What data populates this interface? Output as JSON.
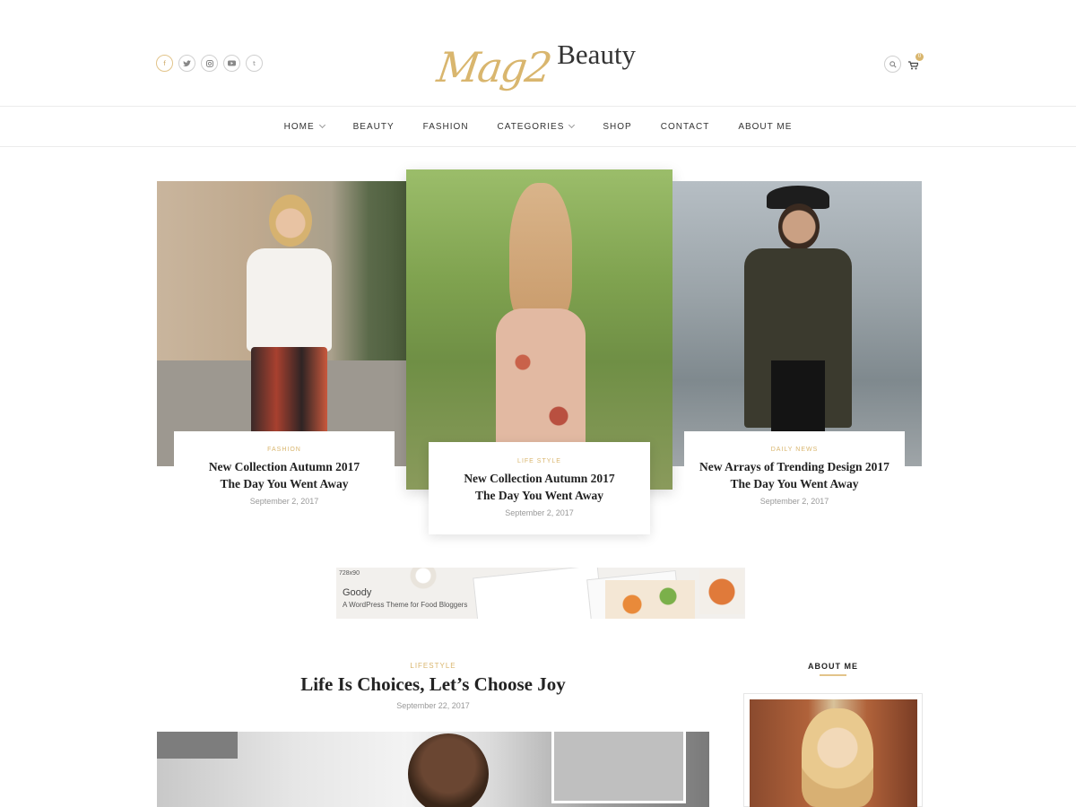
{
  "header": {
    "logo_script": "Mag2",
    "logo_word": "Beauty",
    "social": [
      "f",
      "t",
      "i",
      "y",
      "t"
    ],
    "cart_count": "0"
  },
  "nav": {
    "items": [
      {
        "label": "HOME",
        "has_dropdown": true
      },
      {
        "label": "BEAUTY",
        "has_dropdown": false
      },
      {
        "label": "FASHION",
        "has_dropdown": false
      },
      {
        "label": "CATEGORIES",
        "has_dropdown": true
      },
      {
        "label": "SHOP",
        "has_dropdown": false
      },
      {
        "label": "CONTACT",
        "has_dropdown": false
      },
      {
        "label": "ABOUT ME",
        "has_dropdown": false
      }
    ]
  },
  "slider": [
    {
      "category": "FASHION",
      "title_line1": "New Collection Autumn 2017",
      "title_line2": "The Day You Went Away",
      "date": "September 2, 2017"
    },
    {
      "category": "LIFE STYLE",
      "title_line1": "New Collection Autumn 2017",
      "title_line2": "The Day You Went Away",
      "date": "September 2, 2017"
    },
    {
      "category": "DAILY NEWS",
      "title_line1": "New Arrays of Trending Design 2017",
      "title_line2": "The Day You Went Away",
      "date": "September 2, 2017"
    }
  ],
  "ad": {
    "size": "728x90",
    "name": "Goody",
    "tagline": "A WordPress Theme for Food Bloggers"
  },
  "post": {
    "category": "LIFESTYLE",
    "title": "Life Is Choices, Let’s Choose Joy",
    "date": "September 22, 2017"
  },
  "sidebar": {
    "title": "ABOUT ME"
  },
  "colors": {
    "accent": "#d9b66e",
    "text": "#222222",
    "muted": "#999999"
  }
}
